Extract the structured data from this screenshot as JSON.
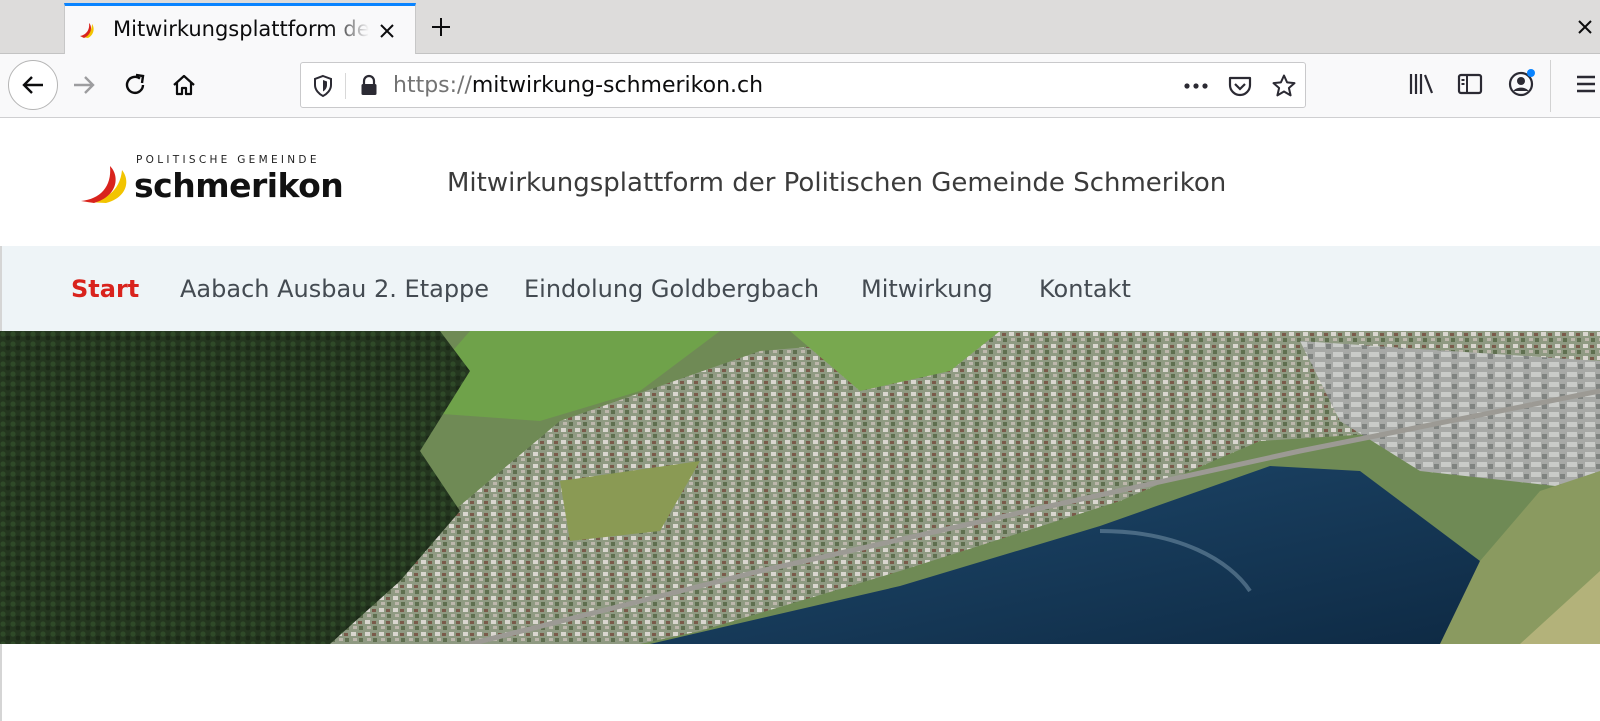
{
  "browser": {
    "tab": {
      "title": "Mitwirkungsplattform der Politischen Gemeinde Schmerikon",
      "close_icon": "close-icon"
    },
    "new_tab_icon": "plus-icon",
    "window_close_icon": "close-icon",
    "url": {
      "scheme": "https://",
      "host": "mitwirkung-schmerikon.ch"
    },
    "toolbar_icons": [
      "back-arrow-icon",
      "forward-arrow-icon",
      "reload-icon",
      "home-icon",
      "shield-icon",
      "lock-icon",
      "more-icon",
      "pocket-icon",
      "star-icon",
      "library-icon",
      "sidebar-icon",
      "account-icon",
      "menu-icon"
    ],
    "accent_color": "#0a84ff"
  },
  "site": {
    "logo": {
      "small_text": "POLITISCHE GEMEINDE",
      "name": "schmerikon"
    },
    "title": "Mitwirkungsplattform der Politischen Gemeinde Schmerikon",
    "nav": [
      {
        "label": "Start",
        "active": true
      },
      {
        "label": "Aabach Ausbau 2. Etappe",
        "active": false
      },
      {
        "label": "Eindolung Goldbergbach",
        "active": false
      },
      {
        "label": "Mitwirkung",
        "active": false
      },
      {
        "label": "Kontakt",
        "active": false
      }
    ],
    "active_color": "#d9231d"
  }
}
